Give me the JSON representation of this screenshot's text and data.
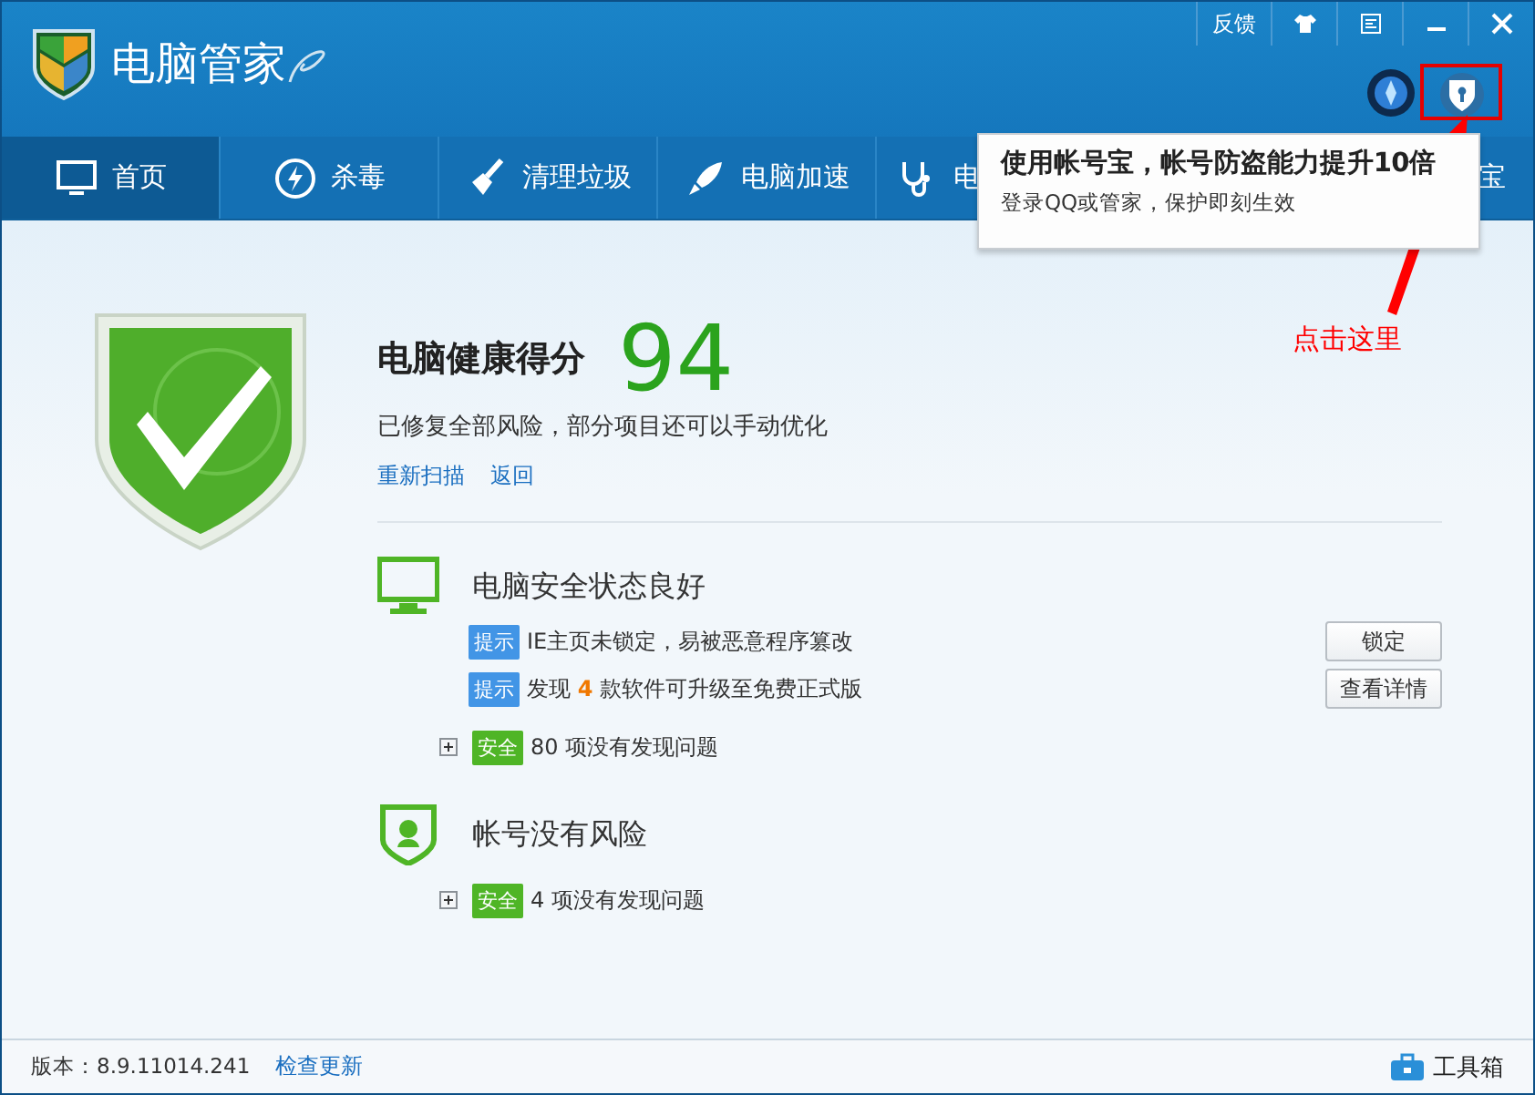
{
  "window": {
    "title": "电脑管家",
    "controls": [
      {
        "kind": "text",
        "label": "反馈"
      },
      {
        "kind": "shirt"
      },
      {
        "kind": "menu"
      },
      {
        "kind": "minimize"
      },
      {
        "kind": "close"
      }
    ]
  },
  "tabs": [
    {
      "label": "首页",
      "selected": true
    },
    {
      "label": "杀毒",
      "selected": false
    },
    {
      "label": "清理垃圾",
      "selected": false
    },
    {
      "label": "电脑加速",
      "selected": false
    },
    {
      "label": "电",
      "selected": false
    },
    {
      "label": "宝",
      "selected": false
    }
  ],
  "tooltip": {
    "title": "使用帐号宝，帐号防盗能力提升10倍",
    "text": "登录QQ或管家，保护即刻生效"
  },
  "score": {
    "label": "电脑健康得分",
    "value": "94",
    "subtitle": "已修复全部风险，部分项目还可以手动优化",
    "links": [
      "重新扫描",
      "返回"
    ]
  },
  "sections": [
    {
      "title": "电脑安全状态良好",
      "items": [
        {
          "kind": "tip",
          "badge": "提示",
          "text": "IE主页未锁定，易被恶意程序篡改",
          "button": "锁定"
        },
        {
          "kind": "tip",
          "badge": "提示",
          "text": "发现 **4** 款软件可升级至免费正式版",
          "button": "查看详情"
        },
        {
          "kind": "safe",
          "badge": "安全",
          "text": "80 项没有发现问题",
          "expanded": false
        }
      ]
    },
    {
      "title": "帐号没有风险",
      "items": [
        {
          "kind": "safe",
          "badge": "安全",
          "text": "4 项没有发现问题",
          "expanded": false
        }
      ]
    }
  ],
  "annotation": {
    "text": "点击这里"
  },
  "footer": {
    "version": "版本：8.9.11014.241",
    "update_link": "检查更新",
    "toolbox": "工具箱"
  }
}
